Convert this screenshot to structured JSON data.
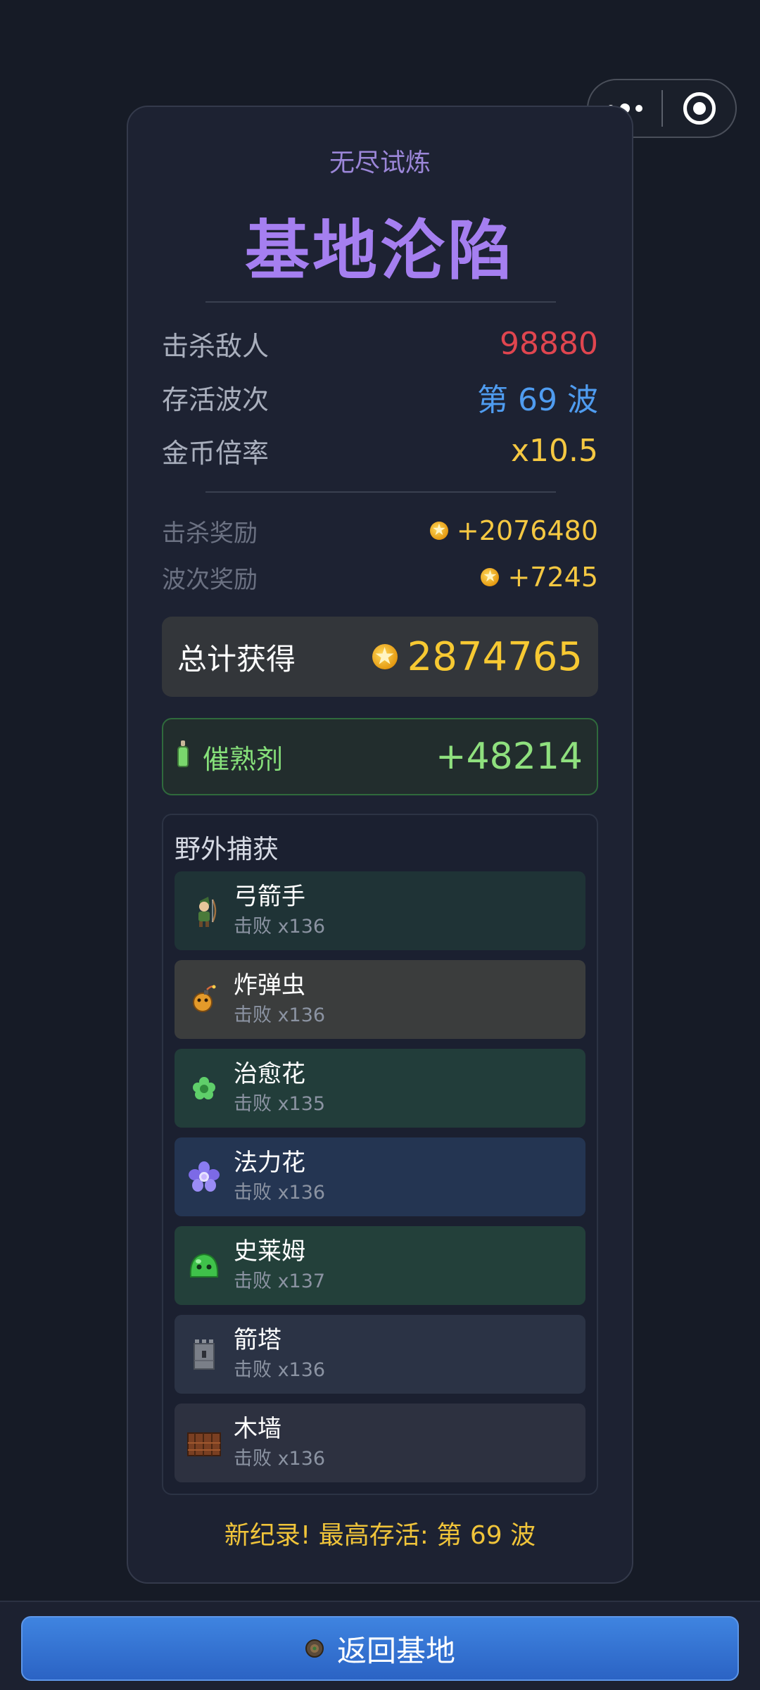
{
  "header": {
    "subtitle": "无尽试炼",
    "title": "基地沦陷"
  },
  "stats": {
    "kills_label": "击杀敌人",
    "kills_value": "98880",
    "waves_label": "存活波次",
    "waves_value": "第 69 波",
    "multiplier_label": "金币倍率",
    "multiplier_value": "x10.5"
  },
  "rewards": {
    "kill_label": "击杀奖励",
    "kill_value": "+2076480",
    "wave_label": "波次奖励",
    "wave_value": "+7245"
  },
  "total": {
    "label": "总计获得",
    "value": "2874765"
  },
  "catalyst": {
    "label": "催熟剂",
    "value": "+48214"
  },
  "capture": {
    "heading": "野外捕获",
    "items": [
      {
        "name": "弓箭手",
        "sub": "击败 x136",
        "icon": "archer-icon"
      },
      {
        "name": "炸弹虫",
        "sub": "击败 x136",
        "icon": "bomb-bug-icon"
      },
      {
        "name": "治愈花",
        "sub": "击败 x135",
        "icon": "healing-flower-icon"
      },
      {
        "name": "法力花",
        "sub": "击败 x136",
        "icon": "mana-flower-icon"
      },
      {
        "name": "史莱姆",
        "sub": "击败 x137",
        "icon": "slime-icon"
      },
      {
        "name": "箭塔",
        "sub": "击败 x136",
        "icon": "arrow-tower-icon"
      },
      {
        "name": "木墙",
        "sub": "击败 x136",
        "icon": "wooden-wall-icon"
      }
    ]
  },
  "record_text": "新纪录! 最高存活: 第 69 波",
  "return_button": "返回基地",
  "colors": {
    "kills": "#e0454f",
    "waves": "#4f9cf0",
    "multiplier": "#f5c842",
    "title": "#a57ff0",
    "button": "#3476d6"
  }
}
